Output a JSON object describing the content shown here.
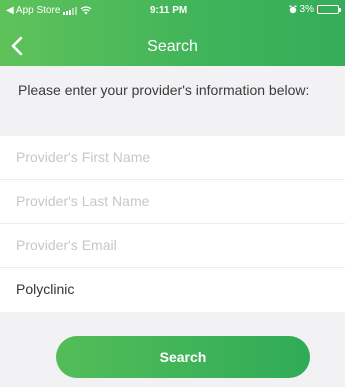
{
  "status_bar": {
    "carrier_back": "◀ App Store",
    "time": "9:11 PM",
    "battery": "3%",
    "battery_level": 0.03
  },
  "navbar": {
    "title": "Search",
    "back_icon": "chevron-left-icon"
  },
  "instructions": "Please enter your provider's information below:",
  "form": {
    "first_name": {
      "value": "",
      "placeholder": "Provider's First Name"
    },
    "last_name": {
      "value": "",
      "placeholder": "Provider's Last Name"
    },
    "email": {
      "value": "",
      "placeholder": "Provider's Email"
    },
    "clinic": {
      "value": "Polyclinic",
      "placeholder": ""
    }
  },
  "search_button_label": "Search",
  "colors": {
    "brand_green": "#3fb45a",
    "background": "#f2f2f4",
    "placeholder": "#c7c7cc"
  }
}
